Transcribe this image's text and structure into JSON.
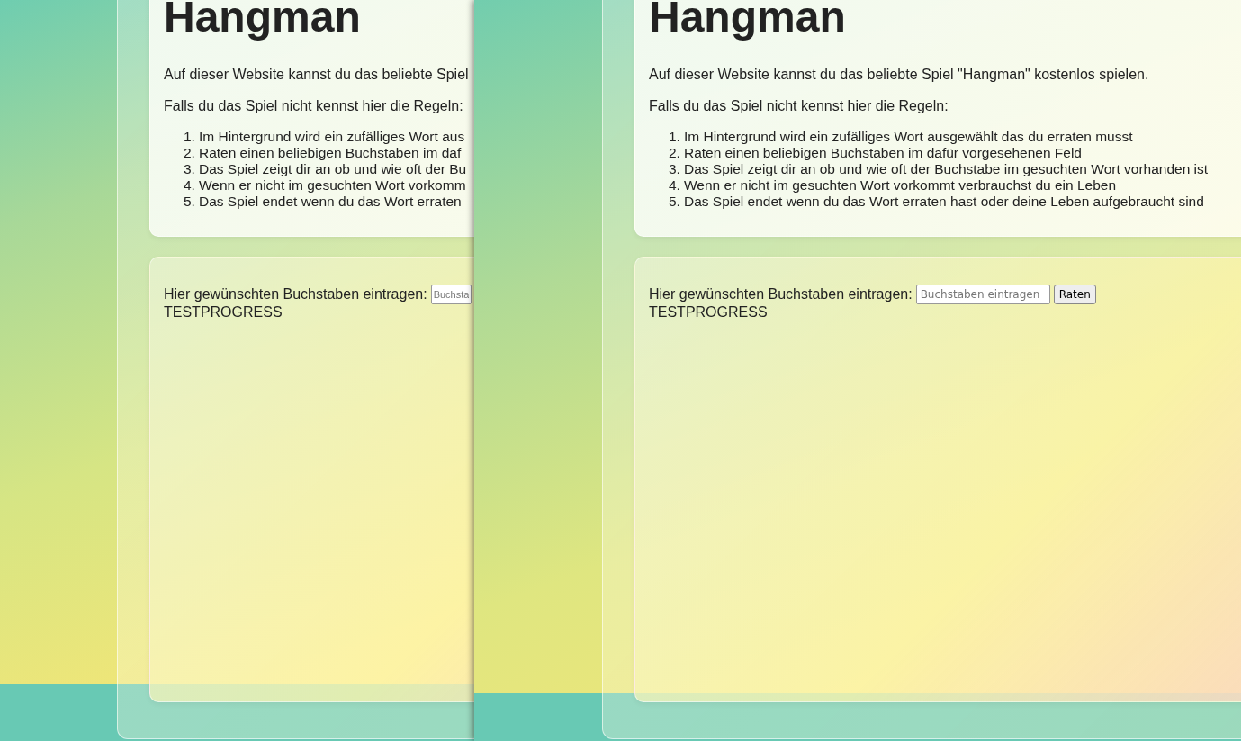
{
  "windows": [
    {
      "title": "Hangman",
      "intro": "Auf dieser Website kannst du das beliebte Spiel",
      "rules_label": "Falls du das Spiel nicht kennst hier die Regeln:",
      "rules": [
        {
          "marker": "1.",
          "text": "Im Hintergrund wird ein zufälliges Wort aus"
        },
        {
          "marker": "2.",
          "text": "Raten einen beliebigen Buchstaben im daf"
        },
        {
          "marker": "3.",
          "text": "Das Spiel zeigt dir an ob und wie oft der Bu"
        },
        {
          "marker": "4.",
          "text": "Wenn er nicht im gesuchten Wort vorkomm"
        },
        {
          "marker": "5.",
          "text": "Das Spiel endet wenn du das Wort erraten"
        }
      ],
      "input_label": "Hier gewünschten Buchstaben eintragen:",
      "input": {
        "placeholder": "Buchsta"
      },
      "progress": "TESTPROGRESS"
    },
    {
      "title": "Hangman",
      "intro": "Auf dieser Website kannst du das beliebte Spiel \"Hangman\" kostenlos spielen.",
      "rules_label": "Falls du das Spiel nicht kennst hier die Regeln:",
      "rules": [
        {
          "marker": "1.",
          "text": "Im Hintergrund wird ein zufälliges Wort ausgewählt das du erraten musst"
        },
        {
          "marker": "2.",
          "text": "Raten einen beliebigen Buchstaben im dafür vorgesehenen Feld"
        },
        {
          "marker": "3.",
          "text": "Das Spiel zeigt dir an ob und wie oft der Buchstabe im gesuchten Wort vorhanden ist"
        },
        {
          "marker": "4.",
          "text": "Wenn er nicht im gesuchten Wort vorkommt verbrauchst du ein Leben"
        },
        {
          "marker": "5.",
          "text": "Das Spiel endet wenn du das Wort erraten hast oder deine Leben aufgebraucht sind"
        }
      ],
      "input_label": "Hier gewünschten Buchstaben eintragen:",
      "input": {
        "placeholder": "Buchstaben eintragen"
      },
      "button": "Raten",
      "progress": "TESTPROGRESS"
    }
  ]
}
